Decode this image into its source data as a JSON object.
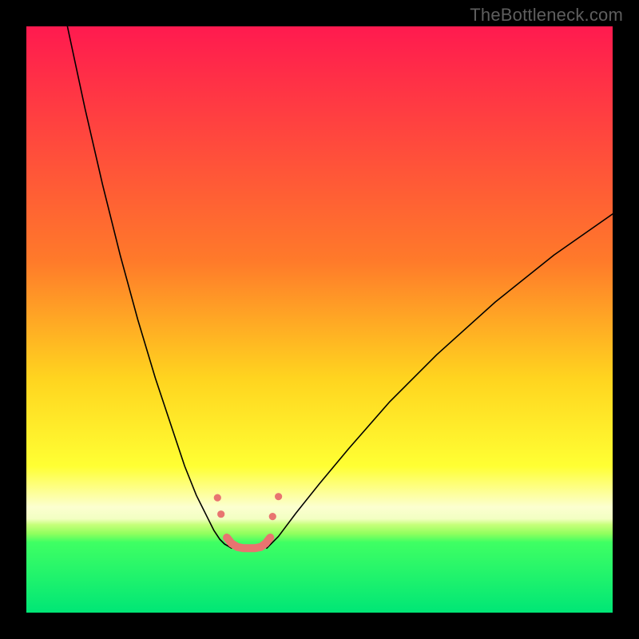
{
  "watermark": "TheBottleneck.com",
  "chart_data": {
    "type": "line",
    "title": "",
    "xlabel": "",
    "ylabel": "",
    "xlim": [
      0,
      100
    ],
    "ylim": [
      0,
      100
    ],
    "gradient_stops": [
      {
        "y": 0,
        "color": "#ff1a4f"
      },
      {
        "y": 40,
        "color": "#ff7a2a"
      },
      {
        "y": 60,
        "color": "#ffd41f"
      },
      {
        "y": 75,
        "color": "#ffff33"
      },
      {
        "y": 82,
        "color": "#fcffd0"
      },
      {
        "y": 84,
        "color": "#f2ffc2"
      },
      {
        "y": 85,
        "color": "#c6ff7a"
      },
      {
        "y": 86.5,
        "color": "#92ff5e"
      },
      {
        "y": 88,
        "color": "#3fff63"
      },
      {
        "y": 100,
        "color": "#00e676"
      }
    ],
    "series": [
      {
        "name": "left-curve",
        "x": [
          7,
          10,
          13,
          16,
          19,
          22,
          25,
          27,
          29,
          31,
          32,
          33,
          33.8,
          34.5,
          35
        ],
        "y": [
          0,
          14,
          27,
          39,
          50,
          60,
          69,
          75,
          80,
          84,
          86,
          87.5,
          88.3,
          88.7,
          89
        ],
        "stroke": "#000",
        "width": 1.6
      },
      {
        "name": "right-curve",
        "x": [
          41,
          43,
          46,
          50,
          55,
          62,
          70,
          80,
          90,
          100
        ],
        "y": [
          89,
          87,
          83,
          78,
          72,
          64,
          56,
          47,
          39,
          32
        ],
        "stroke": "#000",
        "width": 1.6
      }
    ],
    "valley_floor": {
      "name": "valley-floor",
      "x": [
        34.2,
        35,
        36,
        37,
        38,
        39,
        40,
        40.8,
        41.6
      ],
      "y": [
        87.2,
        88.2,
        88.8,
        89,
        89,
        89,
        88.8,
        88.2,
        87.2
      ],
      "stroke": "#e87470",
      "width": 10,
      "linecap": "round"
    },
    "markers": {
      "left_cluster": {
        "x": [
          32.6,
          33.2
        ],
        "y": [
          80.4,
          83.2
        ]
      },
      "right_cluster": {
        "x": [
          42.0,
          43.0
        ],
        "y": [
          83.6,
          80.2
        ]
      },
      "r": 4.6,
      "fill": "#e87470"
    }
  }
}
